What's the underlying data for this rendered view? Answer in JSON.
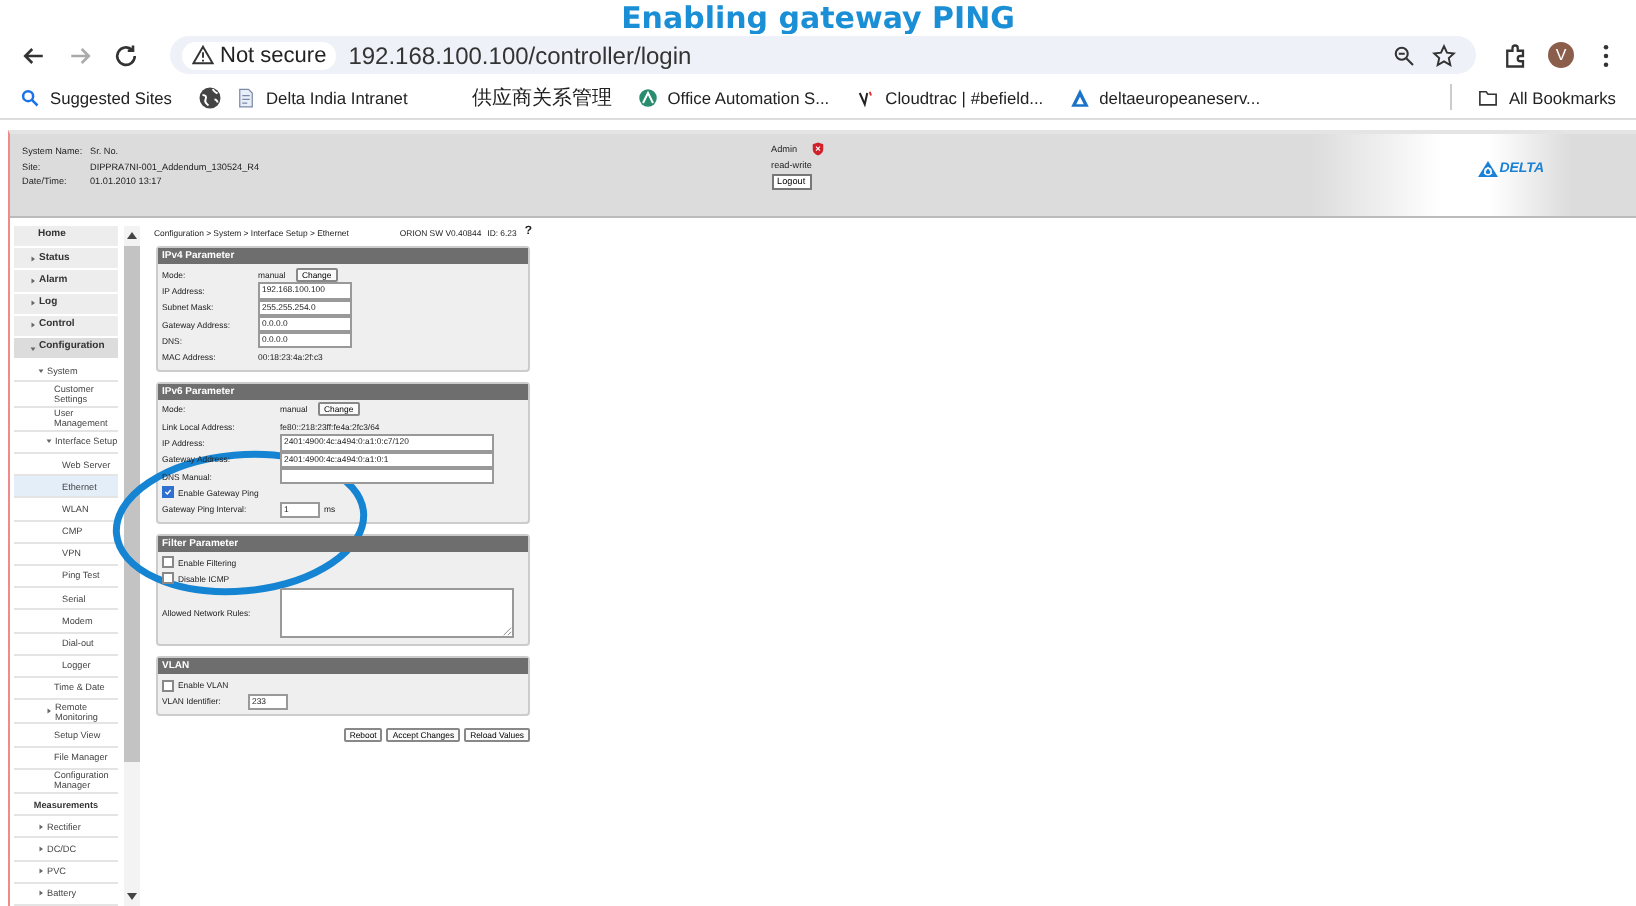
{
  "slide_title": "Enabling gateway PING",
  "browser": {
    "security": "Not secure",
    "url": "192.168.100.100/controller/login",
    "profile_initial": "V",
    "all_bookmarks": "All Bookmarks",
    "bookmarks": [
      {
        "kind": "search",
        "label": "Suggested Sites"
      },
      {
        "kind": "globe"
      },
      {
        "kind": "page",
        "label": "Delta India Intranet"
      },
      {
        "kind": "blank",
        "label": "供应商关系管理"
      },
      {
        "kind": "automation",
        "label": "Office Automation S..."
      },
      {
        "kind": "cloudtrac",
        "label": "Cloudtrac | #befield..."
      },
      {
        "kind": "delta",
        "label": "deltaeuropeaneserv..."
      }
    ]
  },
  "header": {
    "system_info": [
      {
        "label": "System Name:",
        "value": "Sr. No."
      },
      {
        "label": "Site:",
        "value": "DIPPRA7NI-001_Addendum_130524_R4"
      },
      {
        "label": "Date/Time:",
        "value": "01.01.2010 13:17"
      }
    ],
    "user": "Admin",
    "access": "read-write",
    "logout": "Logout",
    "logo": "DELTA"
  },
  "nav": [
    {
      "label": "Home",
      "selected": false
    },
    {
      "label": "Status",
      "expanded": false,
      "selected": false
    },
    {
      "label": "Alarm",
      "expanded": false,
      "selected": false
    },
    {
      "label": "Log",
      "expanded": false,
      "selected": false
    },
    {
      "label": "Control",
      "expanded": false,
      "selected": false
    },
    {
      "label": "Configuration",
      "expanded": true,
      "selected": false,
      "children": [
        {
          "label": "System",
          "expanded": true,
          "selected": false,
          "children": [
            {
              "label": "Customer Settings",
              "selected": false
            },
            {
              "label": "User Management",
              "selected": false
            },
            {
              "label": "Interface Setup",
              "expanded": true,
              "selected": false,
              "children": [
                {
                  "label": "Web Server",
                  "selected": false
                },
                {
                  "label": "Ethernet",
                  "selected": true
                },
                {
                  "label": "WLAN",
                  "selected": false
                },
                {
                  "label": "CMP",
                  "selected": false
                },
                {
                  "label": "VPN",
                  "selected": false
                },
                {
                  "label": "Ping Test",
                  "selected": false
                },
                {
                  "label": "Serial",
                  "selected": false
                },
                {
                  "label": "Modem",
                  "selected": false
                },
                {
                  "label": "Dial-out",
                  "selected": false
                },
                {
                  "label": "Logger",
                  "selected": false
                }
              ]
            },
            {
              "label": "Time & Date",
              "selected": false
            },
            {
              "label": "Remote Monitoring",
              "expanded": false,
              "selected": false
            },
            {
              "label": "Setup View",
              "selected": false
            },
            {
              "label": "File Manager",
              "selected": false
            },
            {
              "label": "Configuration Manager",
              "selected": false
            }
          ]
        }
      ]
    },
    {
      "label": "Measurements",
      "kind": "heading",
      "selected": false,
      "children": [
        {
          "label": "Rectifier",
          "expanded": false,
          "selected": false
        },
        {
          "label": "DC/DC",
          "expanded": false,
          "selected": false
        },
        {
          "label": "PVC",
          "expanded": false,
          "selected": false
        },
        {
          "label": "Battery",
          "expanded": false,
          "selected": false
        }
      ]
    }
  ],
  "breadcrumb": "Configuration > System > Interface Setup > Ethernet",
  "version": "ORION SW V0.40844",
  "device_id": "ID: 6.23",
  "help": "?",
  "panels": [
    {
      "title": "IPv4 Parameter",
      "rows": [
        {
          "kind": "mode",
          "label": "Mode:",
          "value": "manual",
          "button": "Change"
        },
        {
          "kind": "field",
          "label": "IP Address:",
          "value": "192.168.100.100"
        },
        {
          "kind": "field",
          "label": "Subnet Mask:",
          "value": "255.255.254.0"
        },
        {
          "kind": "field",
          "label": "Gateway Address:",
          "value": "0.0.0.0"
        },
        {
          "kind": "field",
          "label": "DNS:",
          "value": "0.0.0.0"
        },
        {
          "kind": "text",
          "label": "MAC Address:",
          "value": "00:18:23:4a:2f:c3"
        }
      ]
    },
    {
      "title": "IPv6 Parameter",
      "rows": [
        {
          "kind": "mode",
          "label": "Mode:",
          "value": "manual",
          "button": "Change"
        },
        {
          "kind": "text",
          "label": "Link Local Address:",
          "value": "fe80::218:23ff:fe4a:2fc3/64"
        },
        {
          "kind": "field",
          "label": "IP Address:",
          "value": "2401:4900:4c:a494:0:a1:0:c7/120"
        },
        {
          "kind": "field",
          "label": "Gateway Address:",
          "value": "2401:4900:4c:a494:0:a1:0:1"
        },
        {
          "kind": "field",
          "label": "DNS Manual:"
        },
        {
          "kind": "check",
          "label": "Enable Gateway Ping",
          "checked": true
        },
        {
          "kind": "field",
          "label": "Gateway Ping Interval:",
          "value": "1",
          "unit": "ms"
        }
      ]
    },
    {
      "title": "Filter Parameter",
      "rows": [
        {
          "kind": "check",
          "label": "Enable Filtering",
          "checked": false
        },
        {
          "kind": "check",
          "label": "Disable ICMP",
          "checked": false
        },
        {
          "kind": "textarea",
          "label": "Allowed Network Rules:"
        }
      ]
    },
    {
      "title": "VLAN",
      "rows": [
        {
          "kind": "check",
          "label": "Enable VLAN",
          "checked": false
        },
        {
          "kind": "field",
          "label": "VLAN Identifier:",
          "value": "233"
        }
      ]
    }
  ],
  "actions": [
    "Reboot",
    "Accept Changes",
    "Reload Values"
  ]
}
